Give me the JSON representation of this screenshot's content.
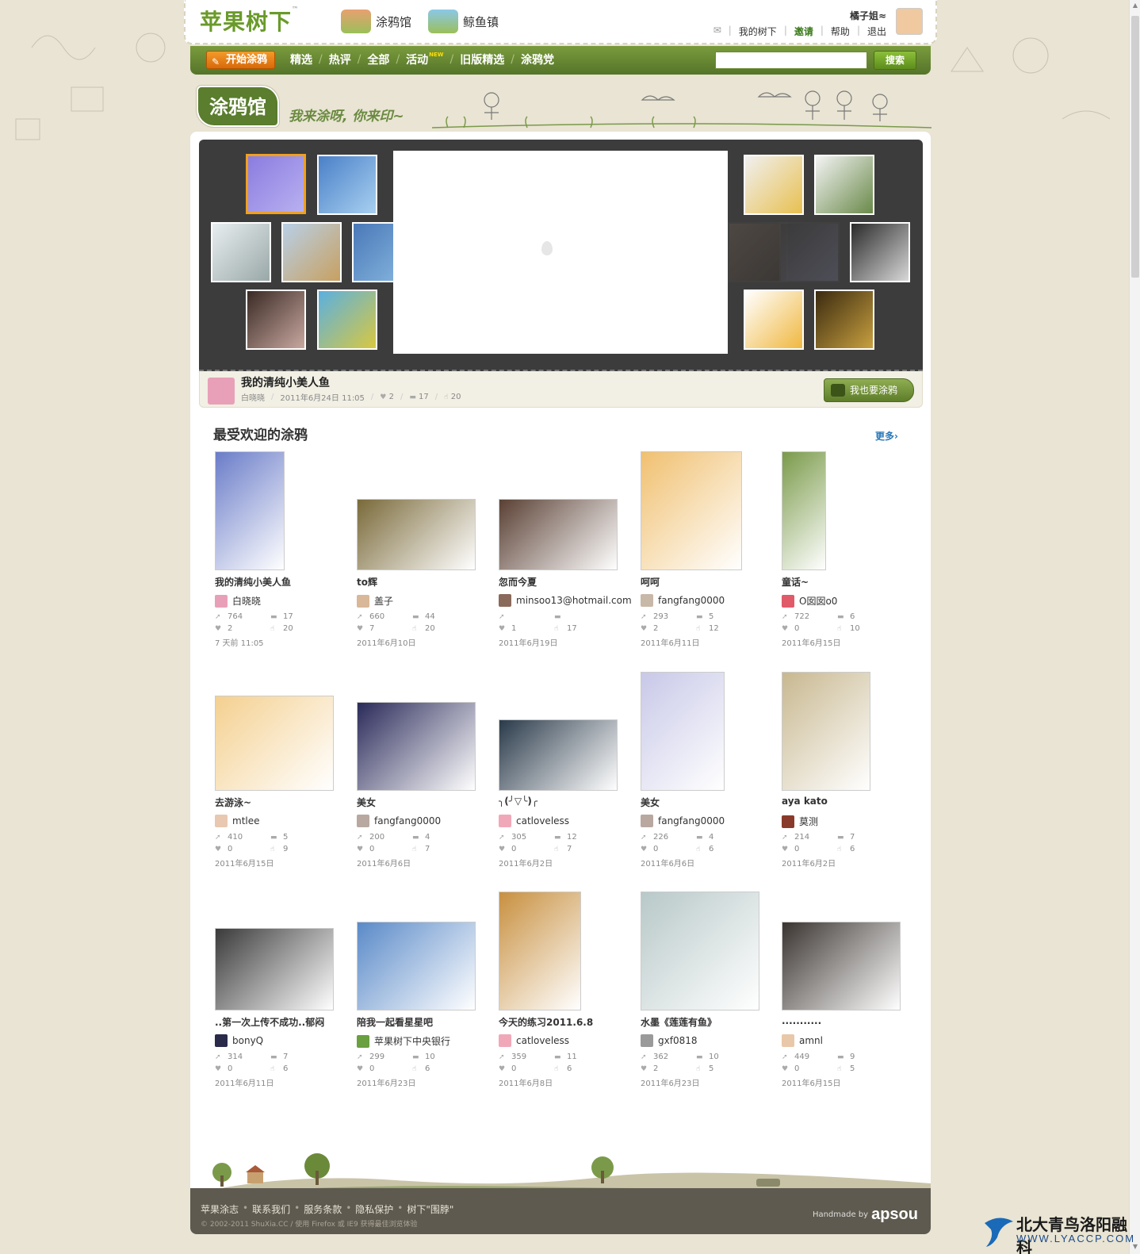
{
  "header": {
    "logo_text": "苹果树下",
    "channels": [
      "涂鸦馆",
      "鲸鱼镇"
    ],
    "user_name": "橘子姐≈",
    "user_links": [
      "我的树下",
      "邀请",
      "帮助",
      "退出"
    ]
  },
  "nav": {
    "start_label": "开始涂鸦",
    "items": [
      "精选",
      "热评",
      "全部",
      "活动",
      "旧版精选",
      "涂鸦党"
    ],
    "new_badge": "NEW",
    "search_value": "",
    "search_button": "搜索"
  },
  "banner": {
    "title": "涂鸦馆",
    "slogan": "我来涂呀, 你来印~"
  },
  "featured": {
    "title": "我的清纯小美人鱼",
    "author": "白晓晓",
    "datetime": "2011年6月24日 11:05",
    "likes": "2",
    "comments": "17",
    "shares": "20",
    "cta": "我也要涂鸦"
  },
  "section": {
    "title": "最受欢迎的涂鸦",
    "more": "更多›"
  },
  "works": [
    {
      "title": "我的清纯小美人鱼",
      "author": "白晓晓",
      "views": "764",
      "comments": "17",
      "likes": "2",
      "shares": "20",
      "date": "7 天前 11:05",
      "color": "#6a7cc8"
    },
    {
      "title": "to辉",
      "author": "盖子",
      "views": "660",
      "comments": "44",
      "likes": "7",
      "shares": "20",
      "date": "2011年6月10日",
      "color": "#7a6a3a"
    },
    {
      "title": "忽而今夏",
      "author": "minsoo13@hotmail.com",
      "views": "",
      "comments": "",
      "likes": "1",
      "shares": "17",
      "date": "2011年6月19日",
      "color": "#5a4034"
    },
    {
      "title": "呵呵",
      "author": "fangfang0000",
      "views": "293",
      "comments": "5",
      "likes": "2",
      "shares": "12",
      "date": "2011年6月11日",
      "color": "#f0c070"
    },
    {
      "title": "童话~",
      "author": "O囡囡o0",
      "views": "722",
      "comments": "6",
      "likes": "0",
      "shares": "10",
      "date": "2011年6月15日",
      "color": "#7a9a4a"
    },
    {
      "title": "去游泳~",
      "author": "mtlee",
      "views": "410",
      "comments": "5",
      "likes": "0",
      "shares": "9",
      "date": "2011年6月15日",
      "color": "#f4d090"
    },
    {
      "title": "美女",
      "author": "fangfang0000",
      "views": "200",
      "comments": "4",
      "likes": "0",
      "shares": "7",
      "date": "2011年6月6日",
      "color": "#2a2a5a"
    },
    {
      "title": "╮(╯▽╰)╭",
      "author": "catloveless",
      "views": "305",
      "comments": "12",
      "likes": "0",
      "shares": "7",
      "date": "2011年6月2日",
      "color": "#2a3a4a"
    },
    {
      "title": "美女",
      "author": "fangfang0000",
      "views": "226",
      "comments": "4",
      "likes": "0",
      "shares": "6",
      "date": "2011年6月6日",
      "color": "#c8c8e8"
    },
    {
      "title": "aya kato",
      "author": "莫测",
      "views": "214",
      "comments": "7",
      "likes": "0",
      "shares": "6",
      "date": "2011年6月2日",
      "color": "#c8b890"
    },
    {
      "title": "..第一次上传不成功..郁闷",
      "author": "bonyQ",
      "views": "314",
      "comments": "7",
      "likes": "0",
      "shares": "6",
      "date": "2011年6月11日",
      "color": "#3a3a3a"
    },
    {
      "title": "陪我一起看星星吧",
      "author": "苹果树下中央银行",
      "views": "299",
      "comments": "10",
      "likes": "0",
      "shares": "6",
      "date": "2011年6月23日",
      "color": "#5a8ac8"
    },
    {
      "title": "今天的练习2011.6.8",
      "author": "catloveless",
      "views": "359",
      "comments": "11",
      "likes": "0",
      "shares": "6",
      "date": "2011年6月8日",
      "color": "#c89040"
    },
    {
      "title": "水墨《莲莲有鱼》",
      "author": "gxf0818",
      "views": "362",
      "comments": "10",
      "likes": "2",
      "shares": "5",
      "date": "2011年6月23日",
      "color": "#b8c8c8"
    },
    {
      "title": "...........",
      "author": "amnl",
      "views": "449",
      "comments": "9",
      "likes": "0",
      "shares": "5",
      "date": "2011年6月15日",
      "color": "#3a3430"
    }
  ],
  "footer": {
    "links": [
      "苹果涂志",
      "联系我们",
      "服务条款",
      "隐私保护",
      "树下\"围脖\""
    ],
    "copyright": "© 2002-2011 ShuXia.CC  /  使用 Firefox 或 IE9 获得最佳浏览体验",
    "handmade": "Handmade by",
    "brand": "apsou"
  },
  "watermark": {
    "line1": "北大青鸟洛阳融科",
    "line2": "WWW.LYACCP.COM"
  }
}
